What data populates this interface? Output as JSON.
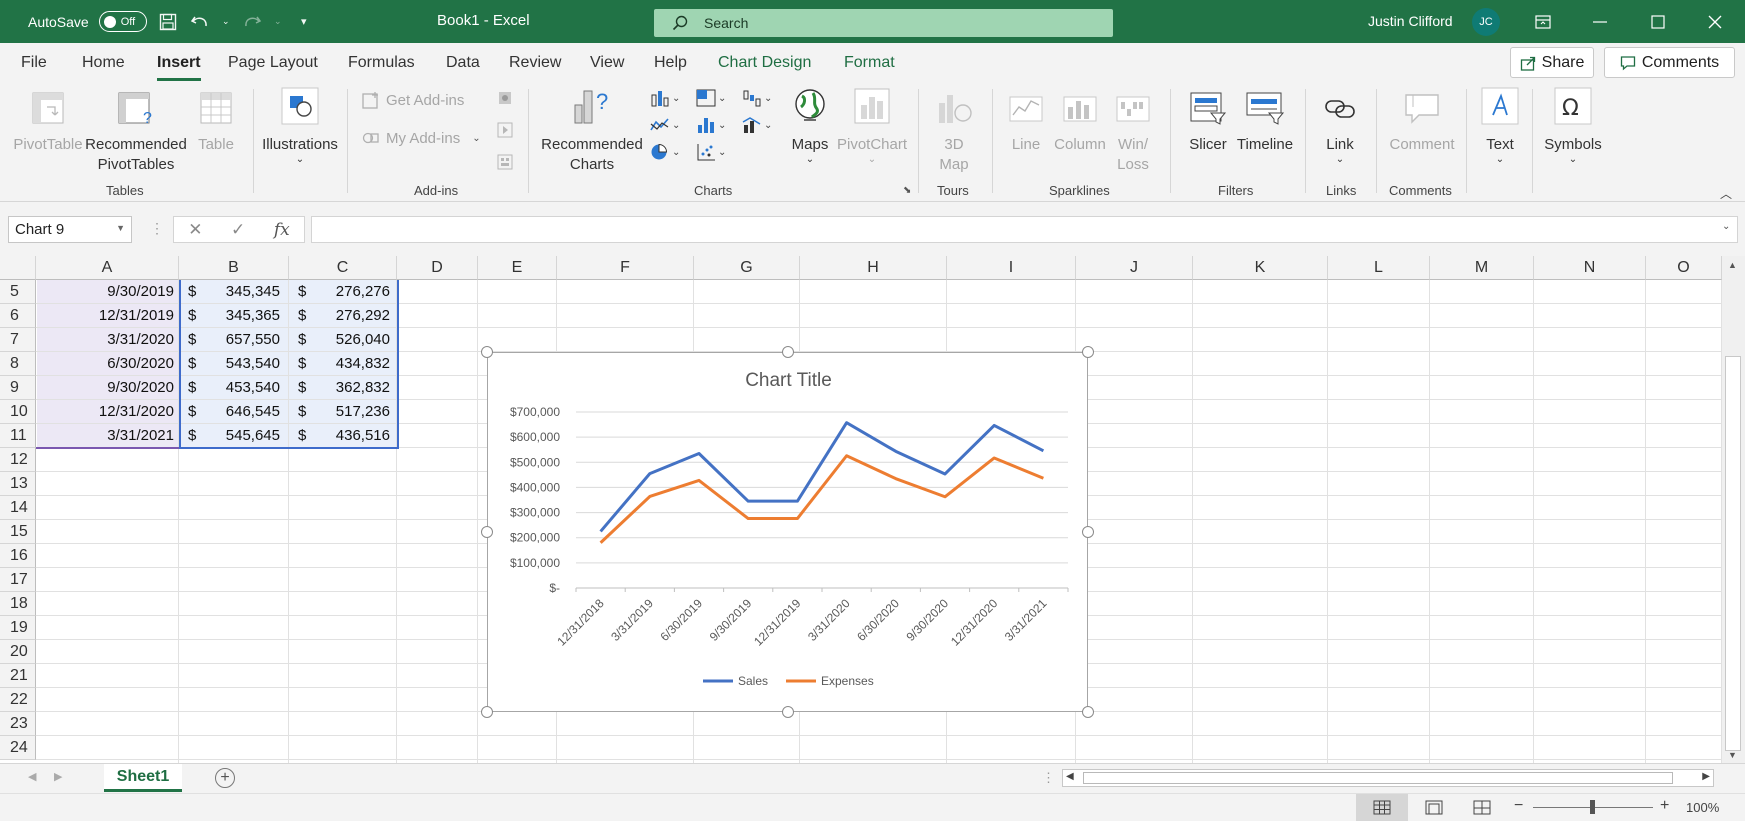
{
  "titlebar": {
    "autosave_label": "AutoSave",
    "autosave_state": "Off",
    "doc_title": "Book1  -  Excel",
    "search_placeholder": "Search",
    "user_name": "Justin Clifford",
    "user_initials": "JC"
  },
  "menu": {
    "tabs": [
      "File",
      "Home",
      "Insert",
      "Page Layout",
      "Formulas",
      "Data",
      "Review",
      "View",
      "Help",
      "Chart Design",
      "Format"
    ],
    "active_tab": "Insert",
    "share_label": "Share",
    "comments_label": "Comments"
  },
  "ribbon": {
    "tables": {
      "label": "Tables",
      "pivottable": "PivotTable",
      "recommended_l1": "Recommended",
      "recommended_l2": "PivotTables",
      "table": "Table"
    },
    "illustrations": {
      "label": "Illustrations"
    },
    "addins": {
      "label": "Add-ins",
      "get": "Get Add-ins",
      "my": "My Add-ins"
    },
    "charts": {
      "label": "Charts",
      "recommended_l1": "Recommended",
      "recommended_l2": "Charts",
      "maps": "Maps",
      "pivotchart": "PivotChart"
    },
    "tours": {
      "label": "Tours",
      "map3d_l1": "3D",
      "map3d_l2": "Map"
    },
    "sparklines": {
      "label": "Sparklines",
      "line": "Line",
      "column": "Column",
      "winloss_l1": "Win/",
      "winloss_l2": "Loss"
    },
    "filters": {
      "label": "Filters",
      "slicer": "Slicer",
      "timeline": "Timeline"
    },
    "links": {
      "label": "Links",
      "link": "Link"
    },
    "comments": {
      "label": "Comments",
      "comment": "Comment"
    },
    "text": {
      "text": "Text"
    },
    "symbols": {
      "symbols": "Symbols"
    }
  },
  "formula_bar": {
    "name_box": "Chart 9",
    "fx": "fx",
    "formula": ""
  },
  "grid": {
    "columns": [
      "A",
      "B",
      "C",
      "D",
      "E",
      "F",
      "G",
      "H",
      "I",
      "J",
      "K",
      "L",
      "M",
      "N",
      "O"
    ],
    "rows": [
      "5",
      "6",
      "7",
      "8",
      "9",
      "10",
      "11",
      "12",
      "13",
      "14",
      "15",
      "16",
      "17",
      "18",
      "19",
      "20",
      "21",
      "22",
      "23",
      "24"
    ],
    "data": [
      {
        "date": "9/30/2019",
        "sales": "345,345",
        "expenses": "276,276"
      },
      {
        "date": "12/31/2019",
        "sales": "345,365",
        "expenses": "276,292"
      },
      {
        "date": "3/31/2020",
        "sales": "657,550",
        "expenses": "526,040"
      },
      {
        "date": "6/30/2020",
        "sales": "543,540",
        "expenses": "434,832"
      },
      {
        "date": "9/30/2020",
        "sales": "453,540",
        "expenses": "362,832"
      },
      {
        "date": "12/31/2020",
        "sales": "646,545",
        "expenses": "517,236"
      },
      {
        "date": "3/31/2021",
        "sales": "545,645",
        "expenses": "436,516"
      }
    ],
    "currency_symbol": "$"
  },
  "chart_data": {
    "type": "line",
    "title": "Chart Title",
    "categories": [
      "12/31/2018",
      "3/31/2019",
      "6/30/2019",
      "9/30/2019",
      "12/31/2019",
      "3/31/2020",
      "6/30/2020",
      "9/30/2020",
      "12/31/2020",
      "3/31/2021"
    ],
    "series": [
      {
        "name": "Sales",
        "color": "#4472c4",
        "values": [
          225000,
          455000,
          535000,
          345345,
          345365,
          657550,
          543540,
          453540,
          646545,
          545645
        ]
      },
      {
        "name": "Expenses",
        "color": "#ed7d31",
        "values": [
          180000,
          364000,
          428000,
          276276,
          276292,
          526040,
          434832,
          362832,
          517236,
          436516
        ]
      }
    ],
    "y_ticks": [
      "$-",
      "$100,000",
      "$200,000",
      "$300,000",
      "$400,000",
      "$500,000",
      "$600,000",
      "$700,000"
    ],
    "ylim": [
      0,
      700000
    ],
    "grid": true,
    "legend_position": "bottom"
  },
  "sheets": {
    "active": "Sheet1"
  },
  "status": {
    "zoom": "100%"
  }
}
